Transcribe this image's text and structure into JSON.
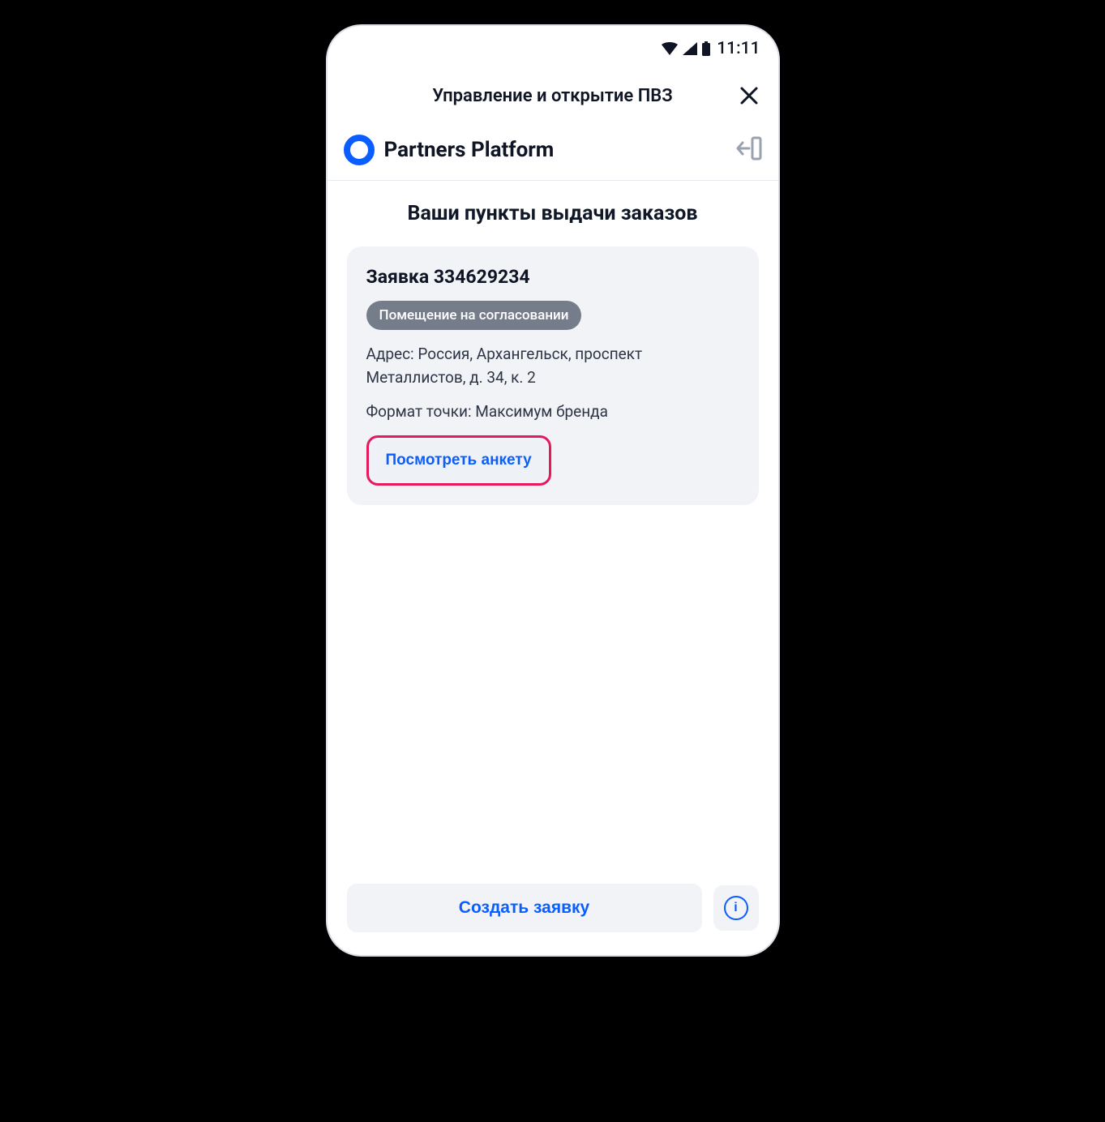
{
  "statusbar": {
    "time": "11:11"
  },
  "topbar": {
    "title": "Управление и открытие ПВЗ"
  },
  "brand": {
    "title": "Partners Platform"
  },
  "section": {
    "title": "Ваши пункты выдачи заказов"
  },
  "card": {
    "title": "Заявка 334629234",
    "status": "Помещение на согласовании",
    "address": "Адрес: Россия, Архангельск, проспект Металлистов, д. 34, к. 2",
    "format": "Формат точки: Максимум бренда",
    "view_label": "Посмотреть анкету"
  },
  "footer": {
    "create_label": "Создать заявку"
  },
  "colors": {
    "accent": "#0a5eff",
    "highlight": "#e6195b",
    "text": "#0f1524",
    "muted_bg": "#f1f3f6",
    "pill_bg": "#767d8a"
  }
}
